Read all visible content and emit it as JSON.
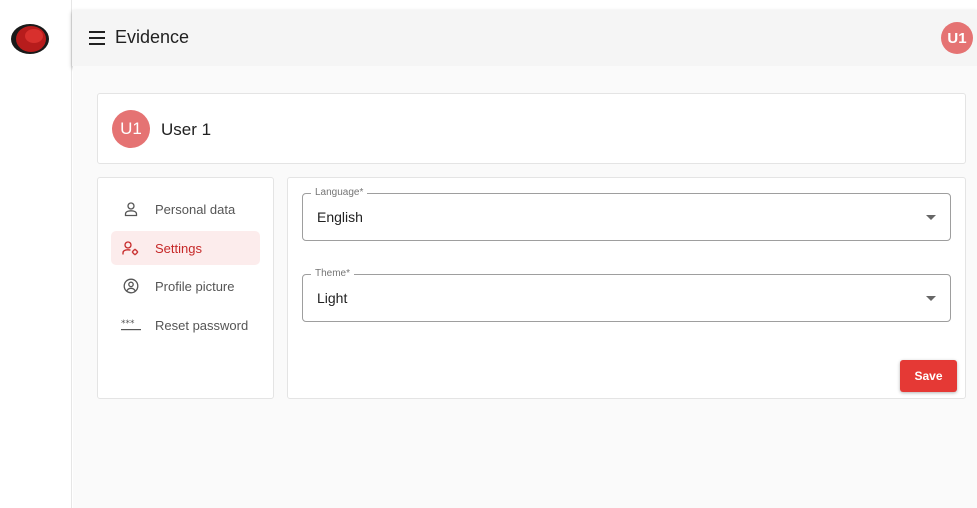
{
  "header": {
    "title": "Evidence",
    "avatar_initials": "U1"
  },
  "profile": {
    "avatar_initials": "U1",
    "name": "User 1"
  },
  "nav": {
    "items": [
      {
        "label": "Personal data",
        "icon": "person-icon",
        "active": false
      },
      {
        "label": "Settings",
        "icon": "user-settings-icon",
        "active": true
      },
      {
        "label": "Profile picture",
        "icon": "account-circle-icon",
        "active": false
      },
      {
        "label": "Reset password",
        "icon": "password-icon",
        "active": false
      }
    ]
  },
  "form": {
    "language": {
      "label": "Language*",
      "value": "English"
    },
    "theme": {
      "label": "Theme*",
      "value": "Light"
    },
    "save_label": "Save"
  },
  "colors": {
    "accent": "#e53935",
    "avatar": "#e57373",
    "active_bg": "#fcecec"
  }
}
